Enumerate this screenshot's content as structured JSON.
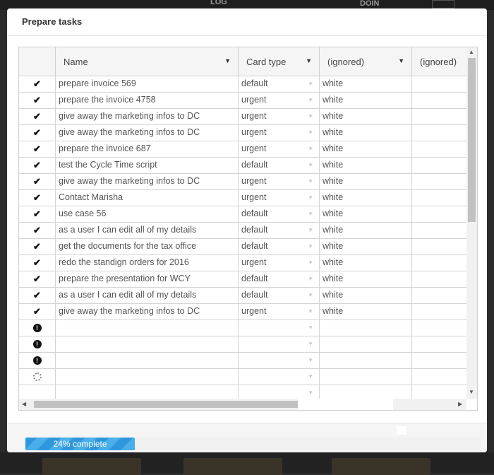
{
  "background": {
    "top_left_text": "LOG",
    "top_right_text": "DOIN"
  },
  "dialog": {
    "title": "Prepare tasks"
  },
  "grid": {
    "columns": [
      {
        "label": "",
        "has_menu": false
      },
      {
        "label": "Name",
        "has_menu": true
      },
      {
        "label": "Card type",
        "has_menu": true
      },
      {
        "label": "(ignored)",
        "has_menu": true
      },
      {
        "label": "(ignored)",
        "has_menu": false
      }
    ],
    "rows": [
      {
        "status": "check",
        "name": "prepare invoice 569",
        "card_type": "default",
        "ignored": "white"
      },
      {
        "status": "check",
        "name": "prepare the invoice 4758",
        "card_type": "urgent",
        "ignored": "white"
      },
      {
        "status": "check",
        "name": "give away the marketing infos to DC",
        "card_type": "urgent",
        "ignored": "white"
      },
      {
        "status": "check",
        "name": "give away the marketing infos to DC",
        "card_type": "urgent",
        "ignored": "white"
      },
      {
        "status": "check",
        "name": "prepare the invoice 687",
        "card_type": "urgent",
        "ignored": "white"
      },
      {
        "status": "check",
        "name": "test the Cycle Time script",
        "card_type": "default",
        "ignored": "white"
      },
      {
        "status": "check",
        "name": "give away the marketing infos to DC",
        "card_type": "urgent",
        "ignored": "white"
      },
      {
        "status": "check",
        "name": "Contact Marisha",
        "card_type": "urgent",
        "ignored": "white"
      },
      {
        "status": "check",
        "name": "use case 56",
        "card_type": "default",
        "ignored": "white"
      },
      {
        "status": "check",
        "name": "as a user I can edit all of my details",
        "card_type": "default",
        "ignored": "white"
      },
      {
        "status": "check",
        "name": "get the documents for the tax office",
        "card_type": "default",
        "ignored": "white"
      },
      {
        "status": "check",
        "name": "redo the standign orders for 2016",
        "card_type": "urgent",
        "ignored": "white"
      },
      {
        "status": "check",
        "name": "prepare the presentation for WCY",
        "card_type": "default",
        "ignored": "white"
      },
      {
        "status": "check",
        "name": "as a user I can edit all of my details",
        "card_type": "default",
        "ignored": "white"
      },
      {
        "status": "check",
        "name": "give away the marketing infos to DC",
        "card_type": "urgent",
        "ignored": "white"
      },
      {
        "status": "alert",
        "name": "",
        "card_type": "",
        "ignored": ""
      },
      {
        "status": "alert",
        "name": "",
        "card_type": "",
        "ignored": ""
      },
      {
        "status": "alert",
        "name": "",
        "card_type": "",
        "ignored": ""
      },
      {
        "status": "loading",
        "name": "",
        "card_type": "",
        "ignored": ""
      },
      {
        "status": "none",
        "name": "",
        "card_type": "",
        "ignored": ""
      }
    ],
    "status_icons": {
      "check": "✔",
      "alert": "!",
      "loading": ""
    }
  },
  "progress": {
    "percent": 24,
    "label": "24% complete",
    "color": "#2f98dc"
  }
}
